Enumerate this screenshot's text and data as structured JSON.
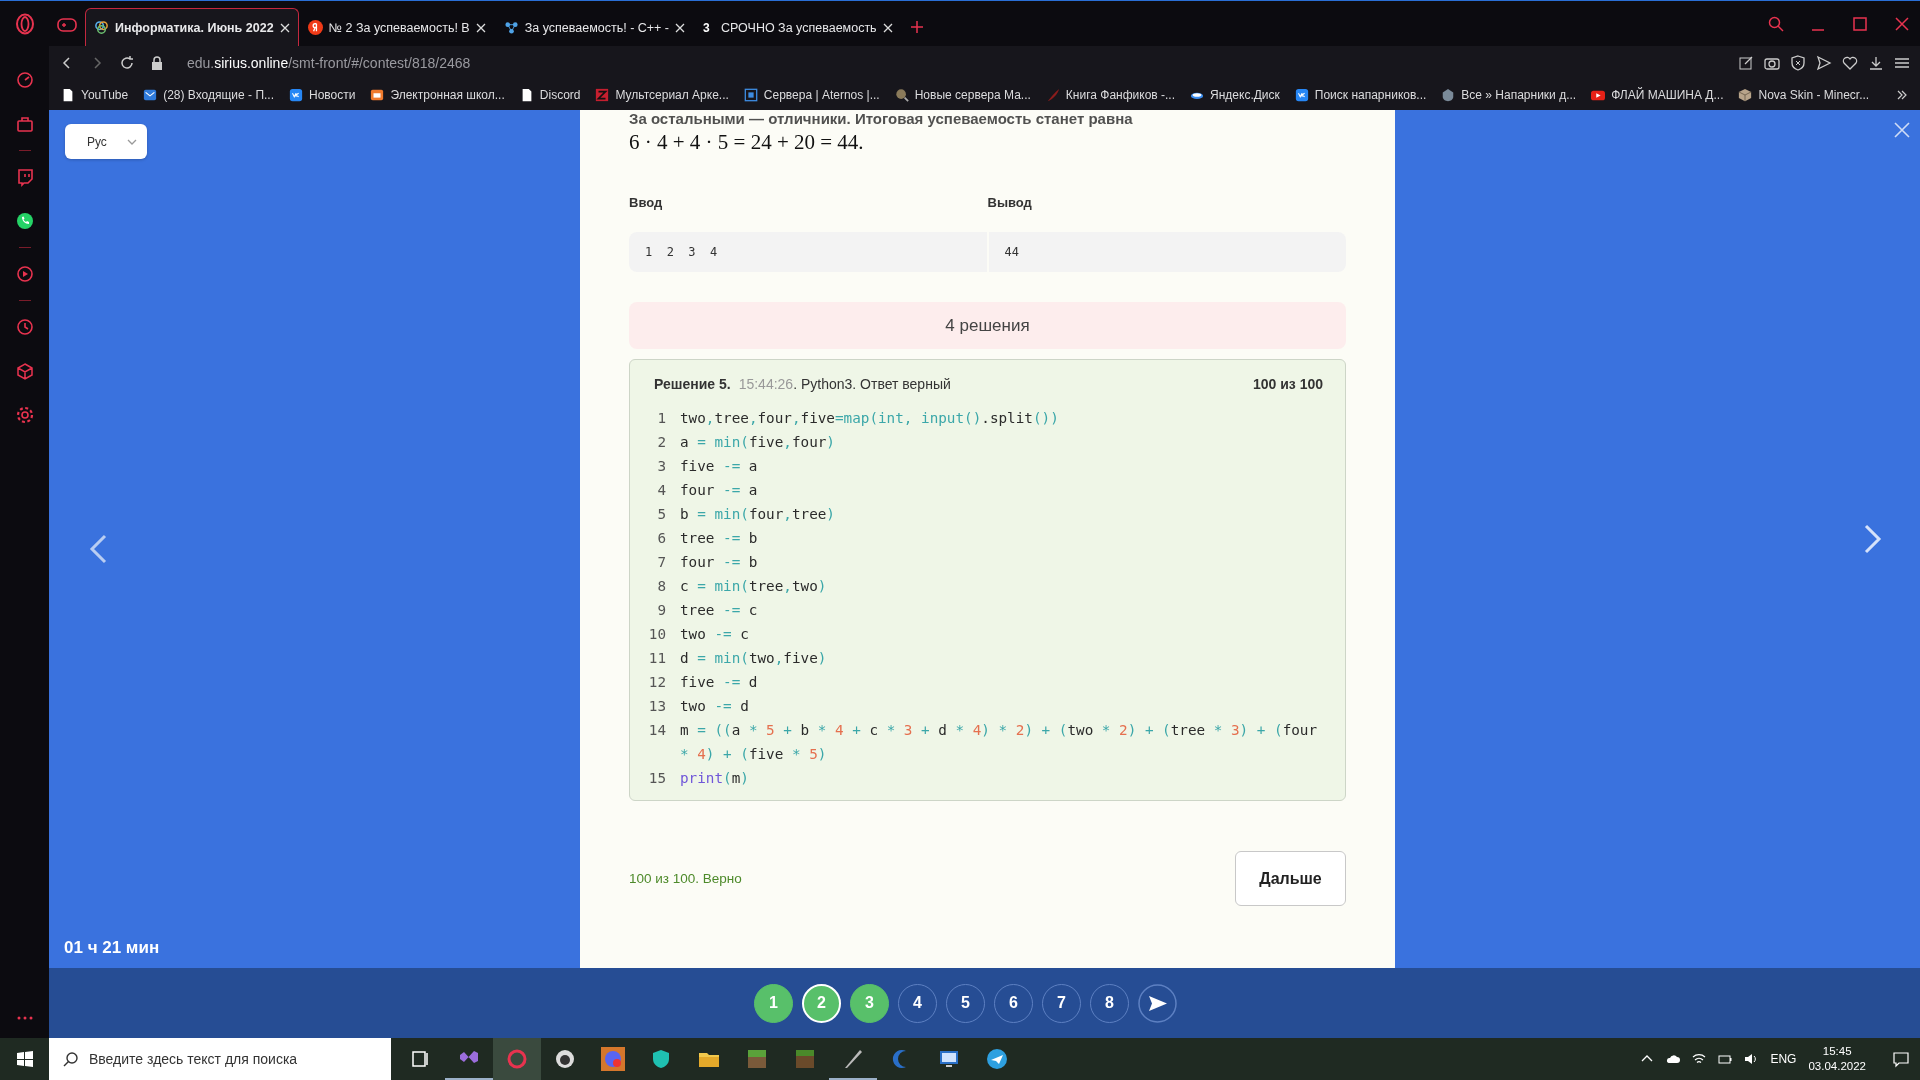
{
  "browser": {
    "tabs": [
      {
        "title": "Информатика. Июнь 2022",
        "selected": true,
        "kind": "rings"
      },
      {
        "title": "№ 2 За успеваемость! В",
        "selected": false,
        "kind": "yandex"
      },
      {
        "title": "За успеваемость! - C++ -",
        "selected": false,
        "kind": "dots"
      },
      {
        "title": "СРОЧНО За успеваемость",
        "selected": false,
        "kind": "digit",
        "badge": "3"
      }
    ],
    "address": "edu.**sirius.online**/smt-front/#/contest/818/2468",
    "bookmarks": [
      {
        "label": "YouTube",
        "kind": "page"
      },
      {
        "label": "(28) Входящие - П...",
        "kind": "mail"
      },
      {
        "label": "Новости",
        "kind": "vk"
      },
      {
        "label": "Электронная школ...",
        "kind": "school"
      },
      {
        "label": "Discord",
        "kind": "page"
      },
      {
        "label": "Мультсериал Арке...",
        "kind": "zed"
      },
      {
        "label": "Сервера | Aternos |...",
        "kind": "frame"
      },
      {
        "label": "Новые сервера Ма...",
        "kind": "ball"
      },
      {
        "label": "Книга Фанфиков -...",
        "kind": "feather"
      },
      {
        "label": "Яндекс.Диск",
        "kind": "disk"
      },
      {
        "label": "Поиск напарников...",
        "kind": "vk"
      },
      {
        "label": "Все » Напарники д...",
        "kind": "ship"
      },
      {
        "label": "ФЛАЙ МАШИНА Д...",
        "kind": "youtube"
      },
      {
        "label": "Nova Skin - Minecr...",
        "kind": "cube"
      }
    ]
  },
  "language": "Рус",
  "statement": {
    "text": "За остальными — отличники. Итоговая успеваемость станет равна",
    "formula": "6 · 4 + 4 · 5 = 24 + 20 = 44."
  },
  "example": {
    "input_label": "Ввод",
    "output_label": "Вывод",
    "input": "1 2 3 4",
    "output": "44"
  },
  "solutions_banner": "4 решения",
  "solution": {
    "title": "Решение 5.",
    "time": "15:44:26",
    "details": ". Python3. Ответ верный",
    "score": "100 из 100",
    "lines": [
      {
        "number": "1",
        "tokens": [
          {
            "kind": "t",
            "text": "two"
          },
          {
            "kind": "o",
            "text": ","
          },
          {
            "kind": "t",
            "text": "tree"
          },
          {
            "kind": "o",
            "text": ","
          },
          {
            "kind": "t",
            "text": "four"
          },
          {
            "kind": "o",
            "text": ","
          },
          {
            "kind": "t",
            "text": "five"
          },
          {
            "kind": "o",
            "text": "=map(int, input()"
          },
          {
            "kind": "t",
            "text": ".split"
          },
          {
            "kind": "o",
            "text": "())"
          }
        ]
      },
      {
        "number": "2",
        "tokens": [
          {
            "kind": "t",
            "text": "a "
          },
          {
            "kind": "o",
            "text": "= min("
          },
          {
            "kind": "t",
            "text": "five"
          },
          {
            "kind": "o",
            "text": ","
          },
          {
            "kind": "t",
            "text": "four"
          },
          {
            "kind": "o",
            "text": ")"
          }
        ]
      },
      {
        "number": "3",
        "tokens": [
          {
            "kind": "t",
            "text": "five "
          },
          {
            "kind": "o",
            "text": "-="
          },
          {
            "kind": "t",
            "text": " a"
          }
        ]
      },
      {
        "number": "4",
        "tokens": [
          {
            "kind": "t",
            "text": "four "
          },
          {
            "kind": "o",
            "text": "-="
          },
          {
            "kind": "t",
            "text": " a"
          }
        ]
      },
      {
        "number": "5",
        "tokens": [
          {
            "kind": "t",
            "text": "b "
          },
          {
            "kind": "o",
            "text": "= min("
          },
          {
            "kind": "t",
            "text": "four"
          },
          {
            "kind": "o",
            "text": ","
          },
          {
            "kind": "t",
            "text": "tree"
          },
          {
            "kind": "o",
            "text": ")"
          }
        ]
      },
      {
        "number": "6",
        "tokens": [
          {
            "kind": "t",
            "text": "tree "
          },
          {
            "kind": "o",
            "text": "-="
          },
          {
            "kind": "t",
            "text": " b"
          }
        ]
      },
      {
        "number": "7",
        "tokens": [
          {
            "kind": "t",
            "text": "four "
          },
          {
            "kind": "o",
            "text": "-="
          },
          {
            "kind": "t",
            "text": " b"
          }
        ]
      },
      {
        "number": "8",
        "tokens": [
          {
            "kind": "t",
            "text": "c "
          },
          {
            "kind": "o",
            "text": "= min("
          },
          {
            "kind": "t",
            "text": "tree"
          },
          {
            "kind": "o",
            "text": ","
          },
          {
            "kind": "t",
            "text": "two"
          },
          {
            "kind": "o",
            "text": ")"
          }
        ]
      },
      {
        "number": "9",
        "tokens": [
          {
            "kind": "t",
            "text": "tree "
          },
          {
            "kind": "o",
            "text": "-="
          },
          {
            "kind": "t",
            "text": " c"
          }
        ]
      },
      {
        "number": "10",
        "tokens": [
          {
            "kind": "t",
            "text": "two "
          },
          {
            "kind": "o",
            "text": "-="
          },
          {
            "kind": "t",
            "text": " c"
          }
        ]
      },
      {
        "number": "11",
        "tokens": [
          {
            "kind": "t",
            "text": "d "
          },
          {
            "kind": "o",
            "text": "= min("
          },
          {
            "kind": "t",
            "text": "two"
          },
          {
            "kind": "o",
            "text": ","
          },
          {
            "kind": "t",
            "text": "five"
          },
          {
            "kind": "o",
            "text": ")"
          }
        ]
      },
      {
        "number": "12",
        "tokens": [
          {
            "kind": "t",
            "text": "five "
          },
          {
            "kind": "o",
            "text": "-="
          },
          {
            "kind": "t",
            "text": " d"
          }
        ]
      },
      {
        "number": "13",
        "tokens": [
          {
            "kind": "t",
            "text": "two "
          },
          {
            "kind": "o",
            "text": "-="
          },
          {
            "kind": "t",
            "text": " d"
          }
        ]
      },
      {
        "number": "14",
        "tokens": [
          {
            "kind": "t",
            "text": "m "
          },
          {
            "kind": "o",
            "text": "= (("
          },
          {
            "kind": "t",
            "text": "a "
          },
          {
            "kind": "o",
            "text": "* "
          },
          {
            "kind": "n",
            "text": "5"
          },
          {
            "kind": "o",
            "text": " + "
          },
          {
            "kind": "t",
            "text": "b "
          },
          {
            "kind": "o",
            "text": "* "
          },
          {
            "kind": "n",
            "text": "4"
          },
          {
            "kind": "o",
            "text": " + "
          },
          {
            "kind": "t",
            "text": "c "
          },
          {
            "kind": "o",
            "text": "* "
          },
          {
            "kind": "n",
            "text": "3"
          },
          {
            "kind": "o",
            "text": " + "
          },
          {
            "kind": "t",
            "text": "d "
          },
          {
            "kind": "o",
            "text": "* "
          },
          {
            "kind": "n",
            "text": "4"
          },
          {
            "kind": "o",
            "text": ") * "
          },
          {
            "kind": "n",
            "text": "2"
          },
          {
            "kind": "o",
            "text": ") + ("
          },
          {
            "kind": "t",
            "text": "two "
          },
          {
            "kind": "o",
            "text": "* "
          },
          {
            "kind": "n",
            "text": "2"
          },
          {
            "kind": "o",
            "text": ") + ("
          },
          {
            "kind": "t",
            "text": "tree "
          },
          {
            "kind": "o",
            "text": "* "
          },
          {
            "kind": "n",
            "text": "3"
          },
          {
            "kind": "o",
            "text": ") + ("
          },
          {
            "kind": "t",
            "text": "four "
          },
          {
            "kind": "o",
            "text": "* "
          },
          {
            "kind": "n",
            "text": "4"
          },
          {
            "kind": "o",
            "text": ") + ("
          },
          {
            "kind": "t",
            "text": "five "
          },
          {
            "kind": "o",
            "text": "* "
          },
          {
            "kind": "n",
            "text": "5"
          },
          {
            "kind": "o",
            "text": ")"
          }
        ]
      },
      {
        "number": "15",
        "tokens": [
          {
            "kind": "p",
            "text": "print"
          },
          {
            "kind": "o",
            "text": "("
          },
          {
            "kind": "t",
            "text": "m"
          },
          {
            "kind": "o",
            "text": ")"
          }
        ]
      }
    ]
  },
  "result": "100 из 100. Верно",
  "next_button": "Дальше",
  "timer": "01 ч 21 мин",
  "problems": [
    {
      "label": "1",
      "solved": true,
      "selected": false
    },
    {
      "label": "2",
      "solved": true,
      "selected": true
    },
    {
      "label": "3",
      "solved": true,
      "selected": false
    },
    {
      "label": "4",
      "solved": false,
      "selected": false
    },
    {
      "label": "5",
      "solved": false,
      "selected": false
    },
    {
      "label": "6",
      "solved": false,
      "selected": false
    },
    {
      "label": "7",
      "solved": false,
      "selected": false
    },
    {
      "label": "8",
      "solved": false,
      "selected": false
    }
  ],
  "taskbar": {
    "search_placeholder": "Введите здесь текст для поиска",
    "language": "ENG",
    "time": "15:45",
    "date": "03.04.2022"
  }
}
